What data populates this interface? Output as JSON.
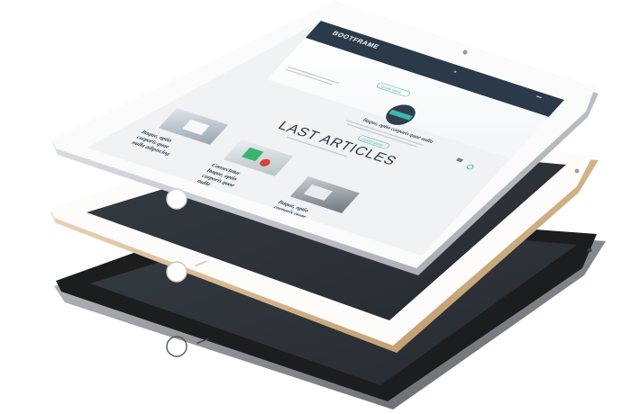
{
  "site": {
    "logo": "BOOTFRAME",
    "hero_button": "LEARN MORE",
    "section_heading": "LAST ARTICLES",
    "cta_button": "LEARN MORE",
    "article_titles": [
      "Itaque, optio corporis quae nulla",
      "Itaque, optio corporis quae nulla",
      "Consectetur Itaque, optio corporis quae nulla",
      "Itaque, optio corporis quae nulla"
    ]
  },
  "devices": [
    {
      "name": "silver-ipad",
      "bezel": "#fbfbfc",
      "rim": "#cdd0d4",
      "screen": "on"
    },
    {
      "name": "gold-ipad",
      "bezel": "#fdfcfb",
      "rim": "#d2b48a",
      "screen": "off"
    },
    {
      "name": "space-gray-ipad",
      "bezel": "#1c1d1f",
      "rim": "#8e9196",
      "screen": "off"
    }
  ],
  "colors": {
    "nav_bar": "#2b3a4a",
    "accent_teal": "#3fb7a9",
    "screen_off": "#2b3136",
    "space_gray_bezel": "#1c1d1f"
  }
}
